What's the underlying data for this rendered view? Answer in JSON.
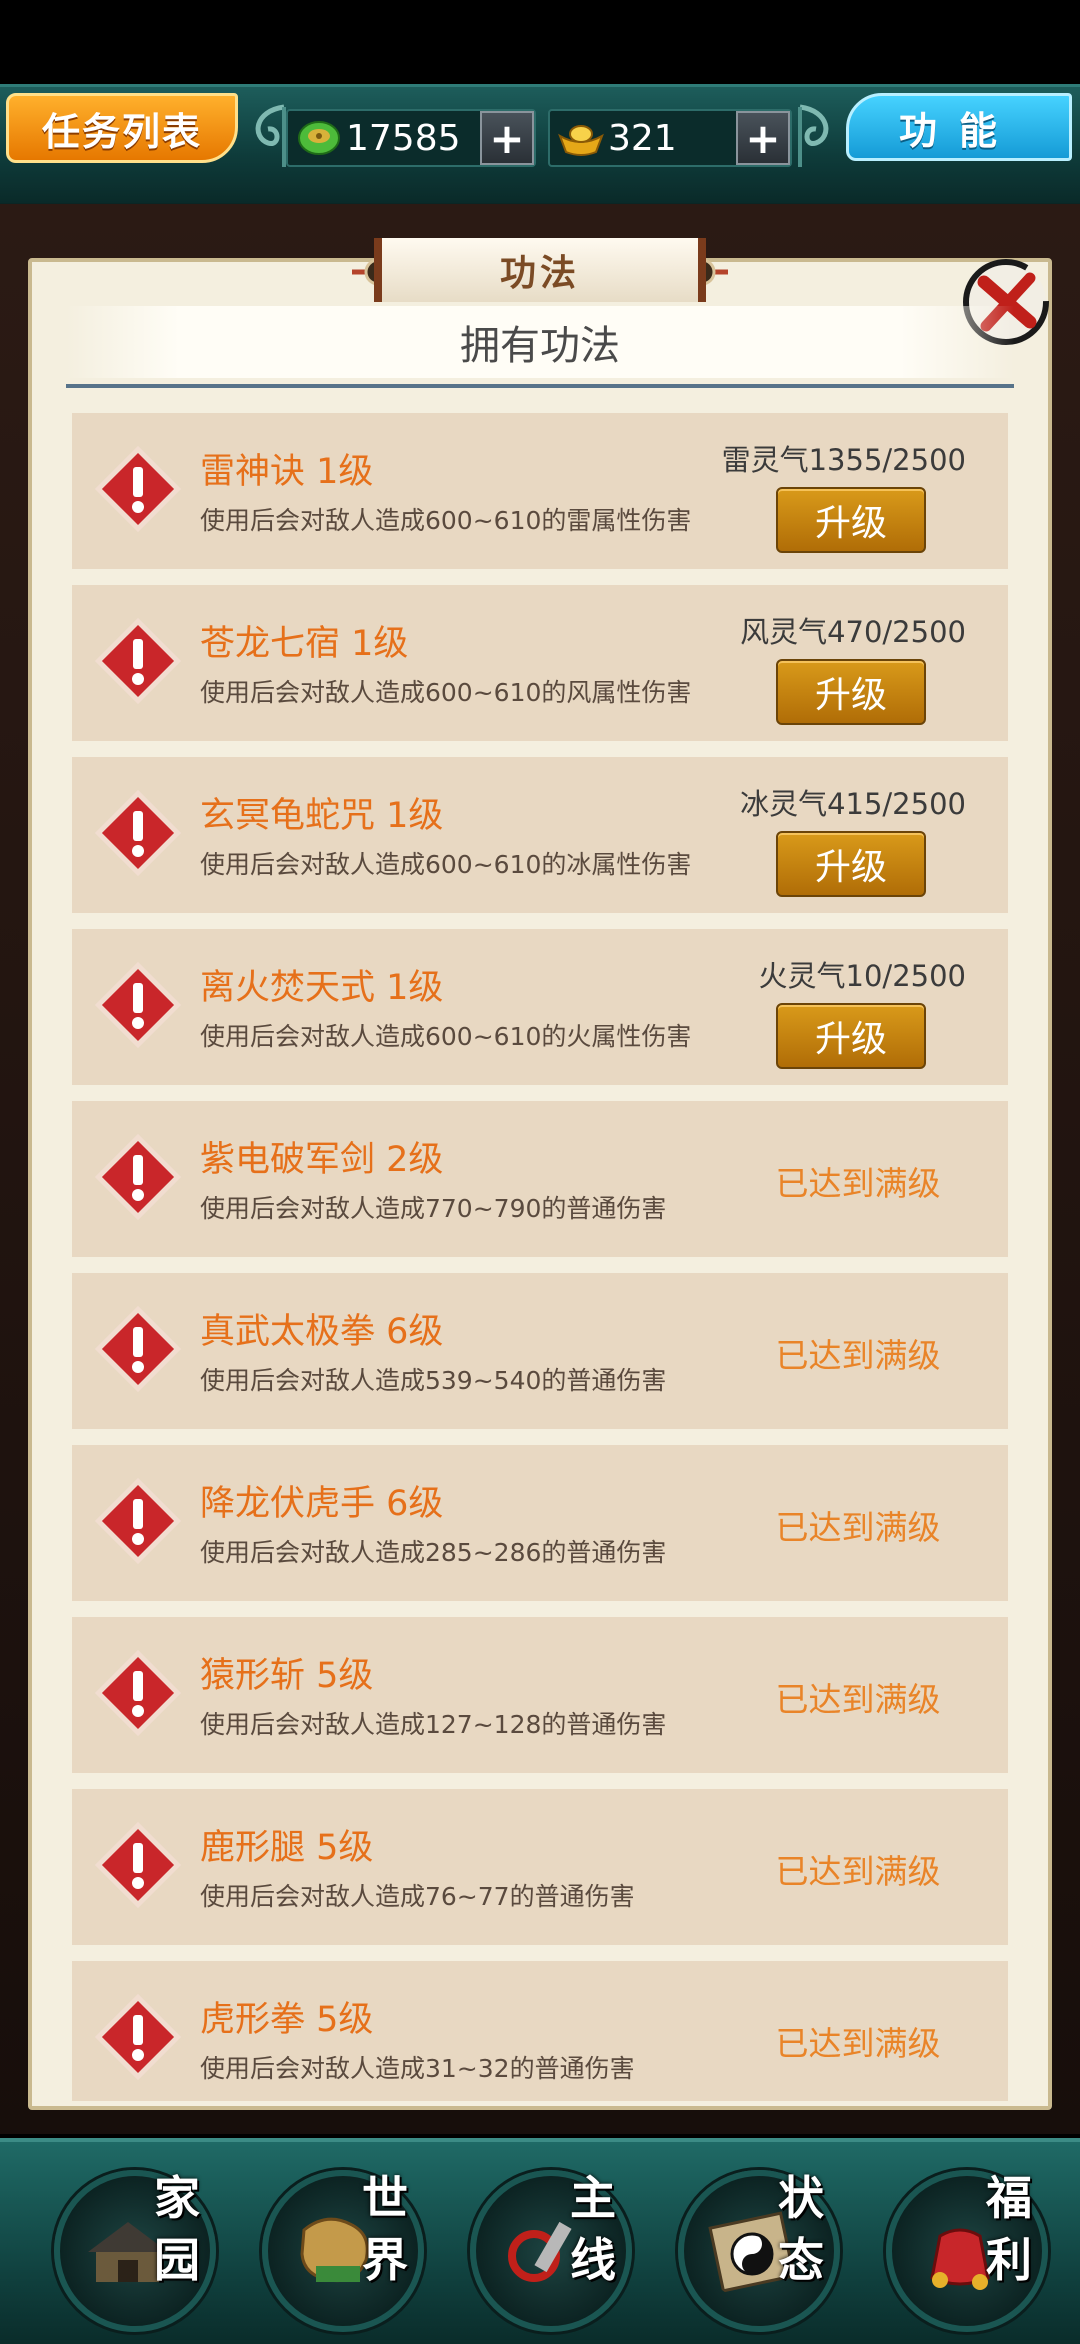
{
  "topbar": {
    "quest_label": "任务列表",
    "jade_value": "17585",
    "gold_value": "321",
    "plus_label": "+",
    "function_label": "功能"
  },
  "panel": {
    "title": "功法",
    "subtitle": "拥有功法"
  },
  "skills": [
    {
      "name": "雷神诀 1级",
      "desc": "使用后会对敌人造成600~610的雷属性伤害",
      "progress": "雷灵气1355/2500",
      "action": "升级"
    },
    {
      "name": "苍龙七宿 1级",
      "desc": "使用后会对敌人造成600~610的风属性伤害",
      "progress": "风灵气470/2500",
      "action": "升级"
    },
    {
      "name": "玄冥龟蛇咒 1级",
      "desc": "使用后会对敌人造成600~610的冰属性伤害",
      "progress": "冰灵气415/2500",
      "action": "升级"
    },
    {
      "name": "离火焚天式 1级",
      "desc": "使用后会对敌人造成600~610的火属性伤害",
      "progress": "火灵气10/2500",
      "action": "升级"
    },
    {
      "name": "紫电破军剑 2级",
      "desc": "使用后会对敌人造成770~790的普通伤害",
      "status": "已达到满级"
    },
    {
      "name": "真武太极拳 6级",
      "desc": "使用后会对敌人造成539~540的普通伤害",
      "status": "已达到满级"
    },
    {
      "name": "降龙伏虎手 6级",
      "desc": "使用后会对敌人造成285~286的普通伤害",
      "status": "已达到满级"
    },
    {
      "name": "猿形斩 5级",
      "desc": "使用后会对敌人造成127~128的普通伤害",
      "status": "已达到满级"
    },
    {
      "name": "鹿形腿 5级",
      "desc": "使用后会对敌人造成76~77的普通伤害",
      "status": "已达到满级"
    },
    {
      "name": "虎形拳 5级",
      "desc": "使用后会对敌人造成31~32的普通伤害",
      "status": "已达到满级"
    }
  ],
  "nav": [
    {
      "c1": "家",
      "c2": "园",
      "icon": "home-icon"
    },
    {
      "c1": "世",
      "c2": "界",
      "icon": "world-map-icon"
    },
    {
      "c1": "主",
      "c2": "线",
      "icon": "main-quest-icon"
    },
    {
      "c1": "状",
      "c2": "态",
      "icon": "bagua-status-icon"
    },
    {
      "c1": "福",
      "c2": "利",
      "icon": "welfare-bag-icon"
    }
  ],
  "colors": {
    "accent_orange": "#e6701a",
    "maxed_orange": "#e98428",
    "panel_bg": "#f4efdf",
    "row_bg": "#e8d8c2",
    "topbar_teal": "#1d5d5b"
  }
}
